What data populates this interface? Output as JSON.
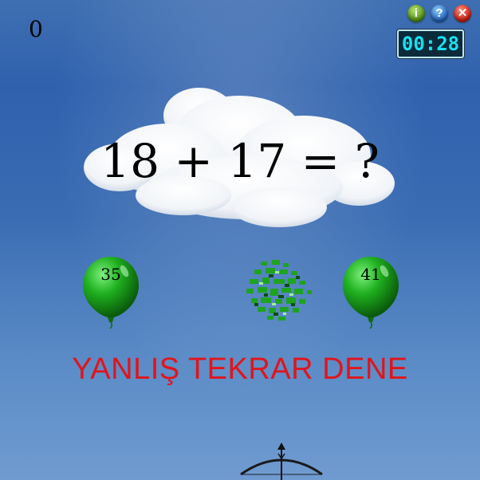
{
  "score": "0",
  "timer": "00:28",
  "controls": {
    "info": "i",
    "help": "?",
    "close": "✕"
  },
  "question": "18 + 17 = ?",
  "balloons": [
    {
      "label": "35",
      "color": "#1aa61a"
    },
    {
      "label": "41",
      "color": "#1aa61a"
    }
  ],
  "message": "YANLIŞ TEKRAR DENE",
  "colors": {
    "message": "#e0151b",
    "timer_text": "#19e0f0"
  }
}
